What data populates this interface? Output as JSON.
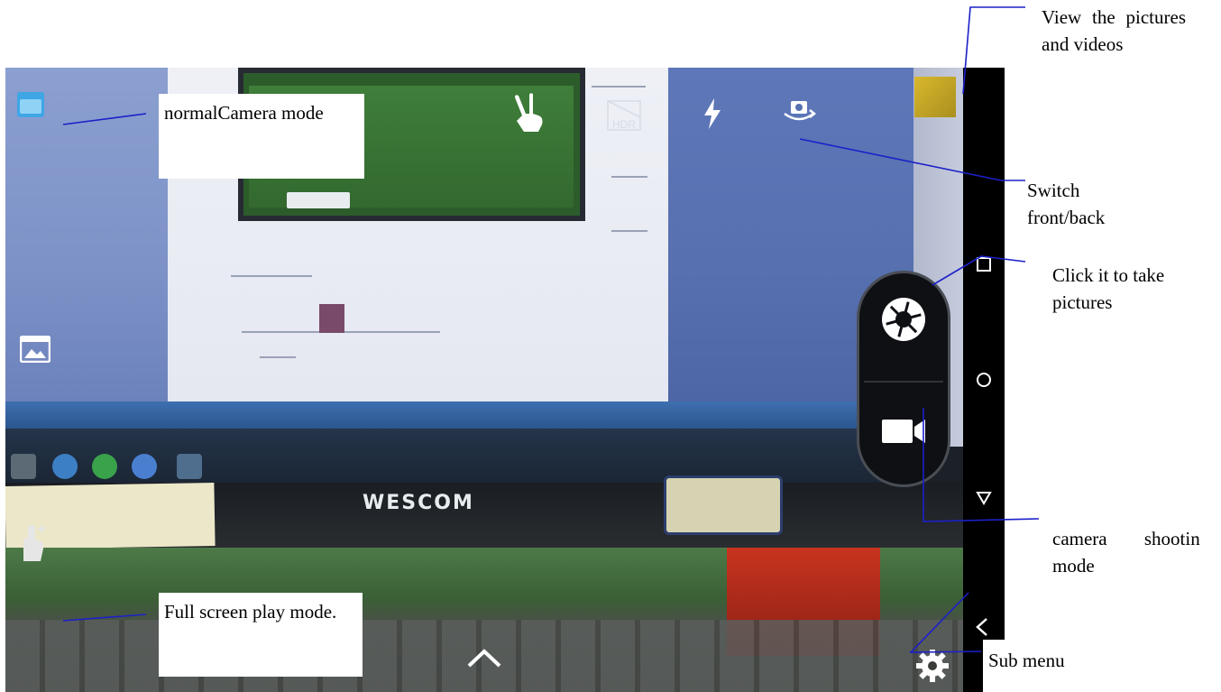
{
  "callouts": {
    "normal_camera_mode": "normalCamera mode",
    "view_pictures_videos": "View the pictures and videos",
    "switch_front_back": "Switch front/back",
    "take_pictures": "Click it to take pictures",
    "camera_shooting_mode": "camera shootin mode",
    "full_screen_play_mode": "Full screen play mode.",
    "sub_menu": "Sub menu"
  },
  "viewfinder": {
    "monitor_brand": "WESCOM"
  },
  "icons": {
    "mode_camera": "camera-mode-icon",
    "mode_video": "video-mode-icon",
    "gesture": "gesture-icon",
    "hdr": "hdr-icon",
    "flash": "flash-icon",
    "switch_camera": "switch-camera-icon",
    "shutter": "shutter-icon",
    "video_record": "video-camera-icon",
    "expand": "chevron-up-icon",
    "settings": "gear-icon",
    "nav_recent": "recent-apps-icon",
    "nav_home": "home-icon",
    "nav_back": "back-icon"
  },
  "colors": {
    "leader_line": "#1c20c8",
    "nav_bar": "#000000",
    "shutter_pill": "#0e1014"
  }
}
